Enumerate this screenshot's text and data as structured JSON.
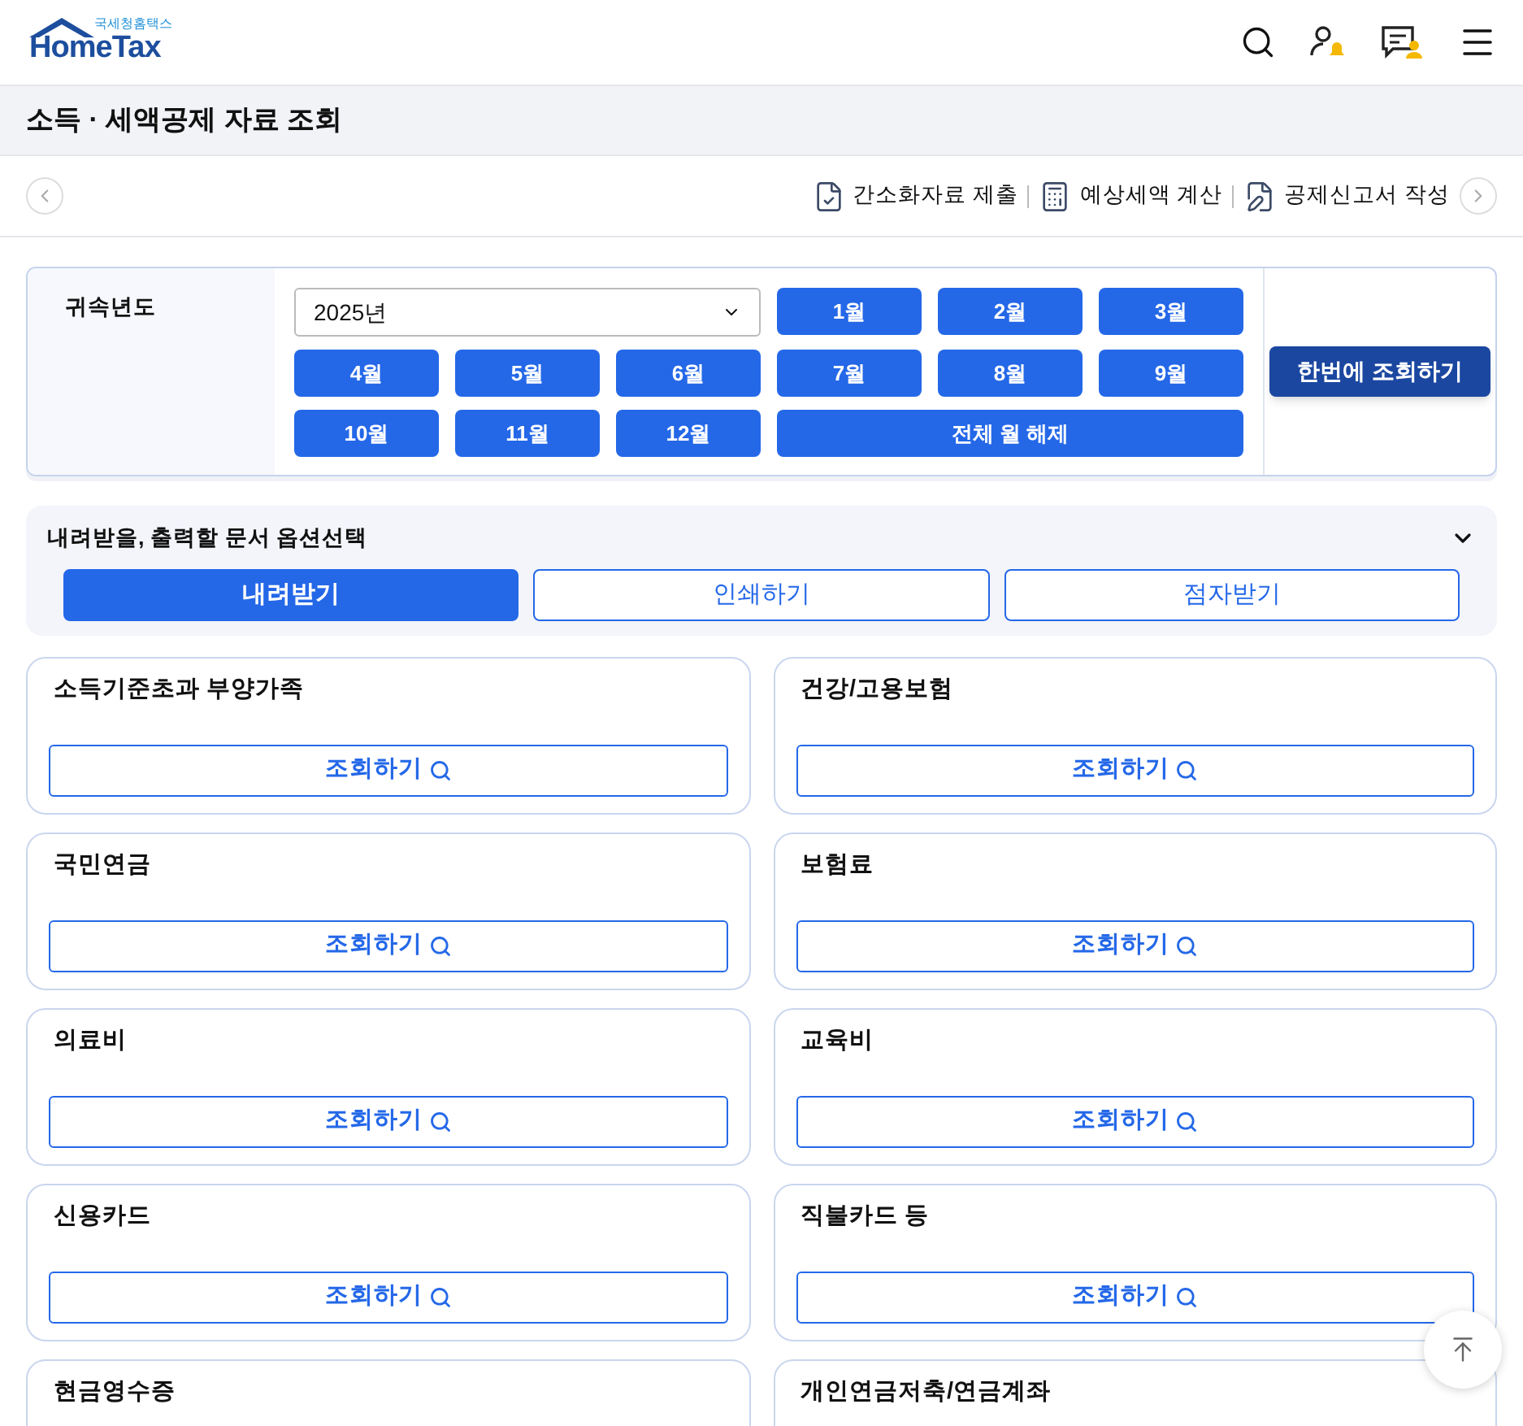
{
  "header": {
    "logo_small": "국세청홈택스",
    "logo": "HomeTax"
  },
  "page_title": "소득 · 세액공제 자료 조회",
  "toolbar": [
    {
      "label": "간소화자료 제출",
      "kind": "submit"
    },
    {
      "label": "예상세액 계산",
      "kind": "calc"
    },
    {
      "label": "공제신고서 작성",
      "kind": "write"
    }
  ],
  "filter": {
    "label": "귀속년도",
    "year": "2025년",
    "months": [
      {
        "label": "1월",
        "selected": true
      },
      {
        "label": "2월",
        "selected": true
      },
      {
        "label": "3월",
        "selected": true
      },
      {
        "label": "4월",
        "selected": true
      },
      {
        "label": "5월",
        "selected": true
      },
      {
        "label": "6월",
        "selected": true
      },
      {
        "label": "7월",
        "selected": true
      },
      {
        "label": "8월",
        "selected": true
      },
      {
        "label": "9월",
        "selected": true
      },
      {
        "label": "10월",
        "selected": true
      },
      {
        "label": "11월",
        "selected": true
      },
      {
        "label": "12월",
        "selected": true
      }
    ],
    "clear_button": "전체 월 해제",
    "search_button": "한번에 조회하기"
  },
  "options": {
    "title": "내려받을, 출력할 문서 옵션선택",
    "expanded": true,
    "tabs": [
      {
        "label": "내려받기",
        "selected": true
      },
      {
        "label": "인쇄하기",
        "selected": false
      },
      {
        "label": "점자받기",
        "selected": false
      }
    ]
  },
  "cards": [
    {
      "title": "소득기준초과 부양가족",
      "button": "조회하기"
    },
    {
      "title": "건강/고용보험",
      "button": "조회하기"
    },
    {
      "title": "국민연금",
      "button": "조회하기"
    },
    {
      "title": "보험료",
      "button": "조회하기"
    },
    {
      "title": "의료비",
      "button": "조회하기"
    },
    {
      "title": "교육비",
      "button": "조회하기"
    },
    {
      "title": "신용카드",
      "button": "조회하기"
    },
    {
      "title": "직불카드 등",
      "button": "조회하기"
    },
    {
      "title": "현금영수증"
    },
    {
      "title": "개인연금저축/연금계좌"
    }
  ]
}
